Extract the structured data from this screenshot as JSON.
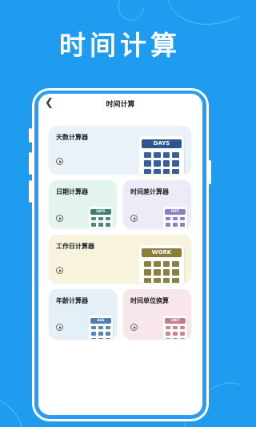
{
  "promo": {
    "title": "时间计算"
  },
  "app": {
    "title": "时间计算",
    "back_icon": "chevron-left-icon"
  },
  "cards": {
    "days": {
      "label": "天数计算器",
      "tag": "DAYS",
      "bg": "#e9f1f9",
      "screen": "#2f5590",
      "key": "#3a5f98"
    },
    "date": {
      "label": "日期计算器",
      "tag": "DATE",
      "bg": "#e3f3ee",
      "screen": "#3e7d70",
      "key": "#4d8a7d"
    },
    "diff": {
      "label": "时间差计算器",
      "tag": "DIFF",
      "bg": "#eeebf8",
      "screen": "#8a7fc7",
      "key": "#8b81c9"
    },
    "work": {
      "label": "工作日计算器",
      "tag": "WORK",
      "bg": "#f7f3dd",
      "screen": "#8b7d3a",
      "key": "#8a7f45"
    },
    "age": {
      "label": "年龄计算器",
      "tag": "AGE",
      "bg": "#e5eff8",
      "screen": "#4f7fb0",
      "key": "#5a86b6"
    },
    "unit": {
      "label": "时间单位换算",
      "tag": "UNIT",
      "bg": "#f8e7ea",
      "screen": "#c67d86",
      "key": "#c98791"
    }
  }
}
